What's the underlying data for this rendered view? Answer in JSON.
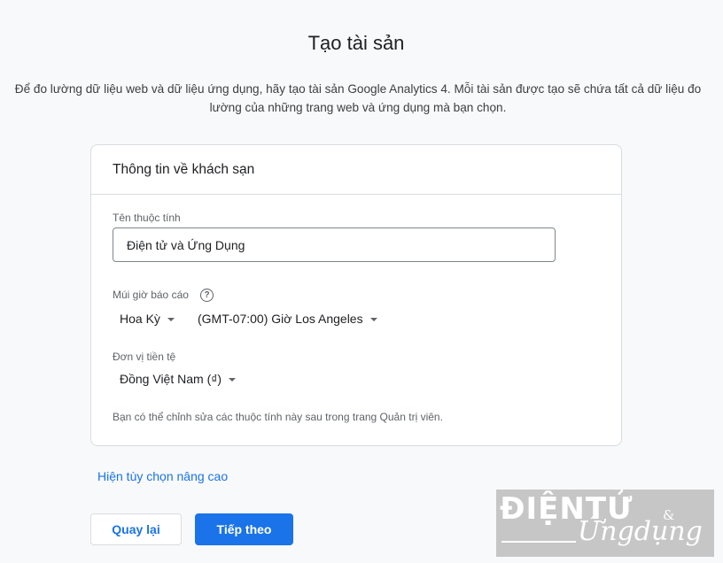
{
  "page": {
    "title": "Tạo tài sản",
    "description": "Để đo lường dữ liệu web và dữ liệu ứng dụng, hãy tạo tài sản Google Analytics 4. Mỗi tài sản được tạo sẽ chứa tất cả dữ liệu đo lường của những trang web và ứng dụng mà bạn chọn."
  },
  "card": {
    "header": "Thông tin về khách sạn",
    "property_name": {
      "label": "Tên thuộc tính",
      "value": "Điện tử và Ứng Dụng"
    },
    "timezone": {
      "label": "Múi giờ báo cáo",
      "help_icon": "help-circle-icon",
      "country": "Hoa Kỳ",
      "zone": "(GMT-07:00) Giờ Los Angeles"
    },
    "currency": {
      "label": "Đơn vị tiền tệ",
      "value": "Đồng Việt Nam (₫)"
    },
    "note": "Bạn có thể chỉnh sửa các thuộc tính này sau trong trang Quản trị viên."
  },
  "advanced_link": "Hiện tùy chọn nâng cao",
  "buttons": {
    "back": "Quay lại",
    "next": "Tiếp theo"
  },
  "watermark": {
    "line1": "ĐIỆNTỬ",
    "amp": "&",
    "line2": "Ứngdụng"
  },
  "colors": {
    "accent": "#1a73e8",
    "background": "#f8f9fa",
    "border": "#dadce0"
  }
}
